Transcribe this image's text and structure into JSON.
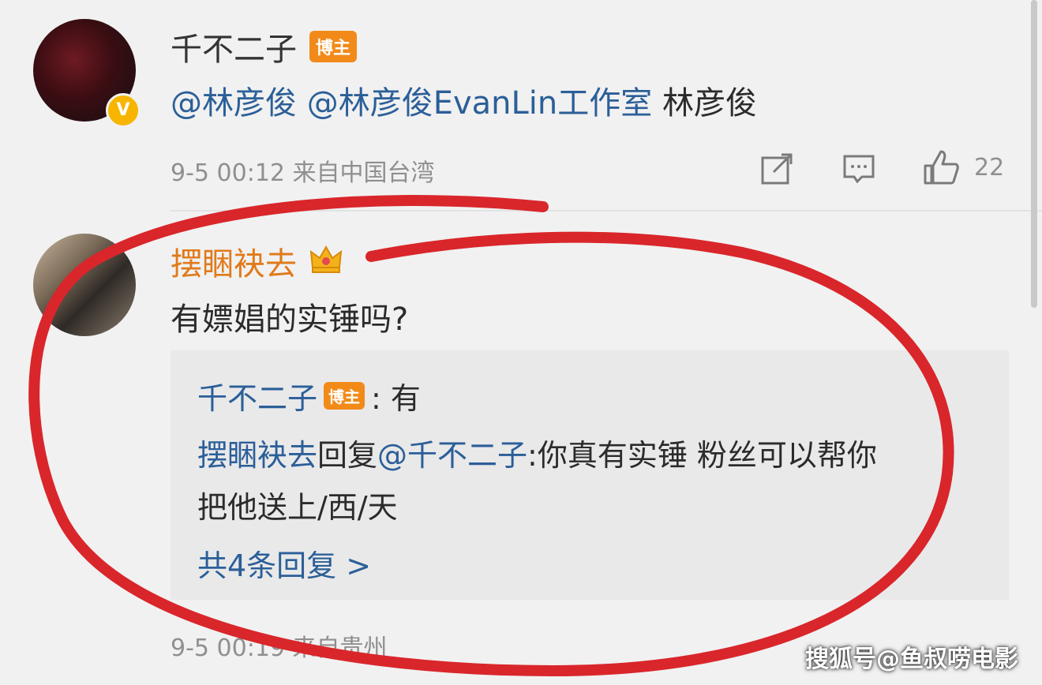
{
  "comment1": {
    "author": "千不二子",
    "badge": "博主",
    "mentions": [
      "@林彦俊",
      "@林彦俊EvanLin工作室"
    ],
    "text_plain": "林彦俊",
    "timestamp": "9-5 00:12",
    "location": "来自中国台湾",
    "like_count": "22",
    "verified_glyph": "V"
  },
  "comment2": {
    "author": "摆睏袂去",
    "text": "有嫖娼的实锤吗?",
    "timestamp": "9-5 00:19",
    "location": "来自贵州"
  },
  "replies": {
    "r1_author": "千不二子",
    "r1_badge": "博主",
    "r1_text": ": 有",
    "r2_author": "摆睏袂去",
    "r2_reply_word": "回复",
    "r2_mention": "@千不二子",
    "r2_text_line1": ":你真有实锤 粉丝可以帮你",
    "r2_text_line2": "把他送上/西/天",
    "more": "共4条回复 >"
  },
  "watermark": "搜狐号@鱼叔唠电影",
  "icons": [
    "share-icon",
    "comment-icon",
    "like-icon",
    "crown-icon",
    "verified-icon"
  ],
  "colors": {
    "link": "#2b5f98",
    "badge": "#f28a1a",
    "annotation": "#d9262b"
  }
}
